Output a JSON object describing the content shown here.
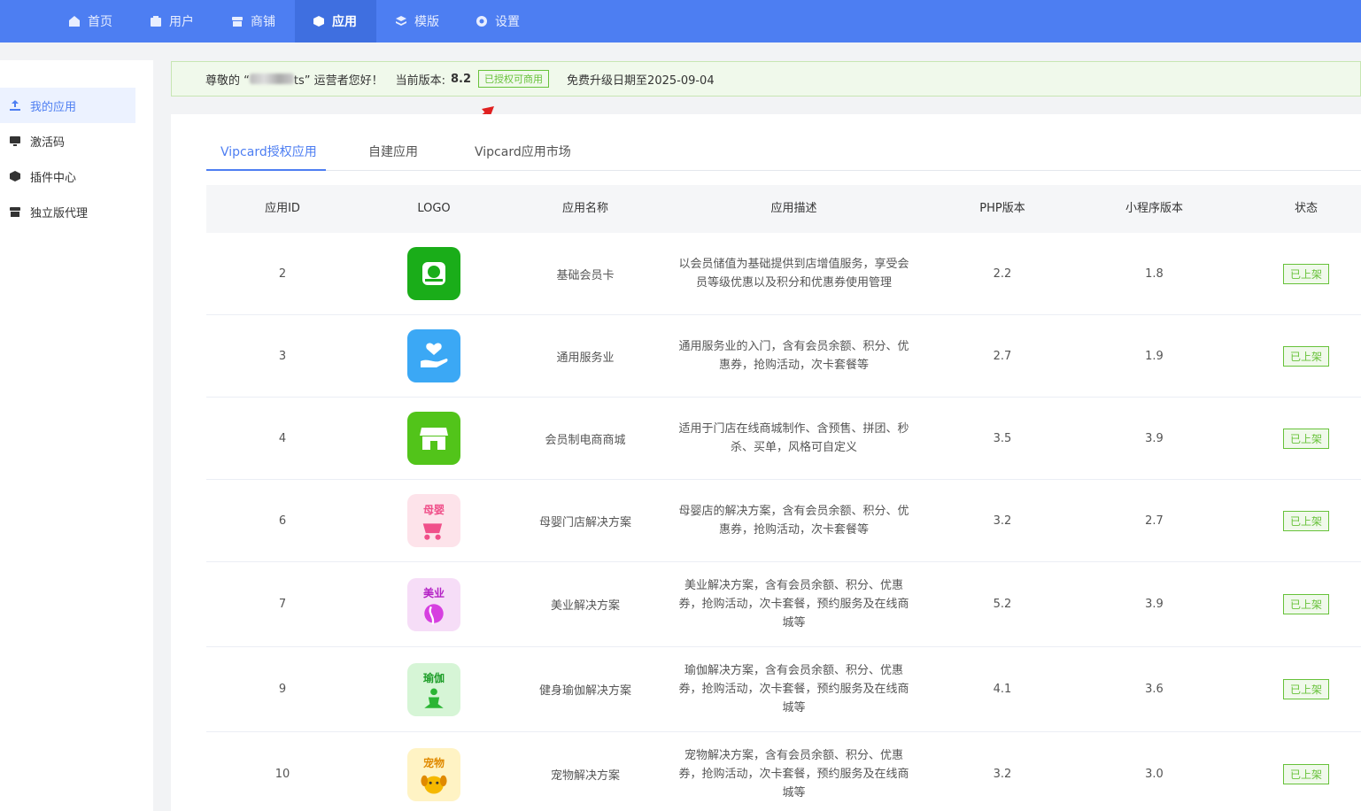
{
  "nav": {
    "items": [
      {
        "label": "首页",
        "icon": "home-icon"
      },
      {
        "label": "用户",
        "icon": "user-icon"
      },
      {
        "label": "商铺",
        "icon": "store-icon"
      },
      {
        "label": "应用",
        "icon": "cube-icon",
        "active": true
      },
      {
        "label": "模版",
        "icon": "layers-icon"
      },
      {
        "label": "设置",
        "icon": "gear-icon"
      }
    ]
  },
  "sidebar": {
    "items": [
      {
        "label": "我的应用",
        "icon": "upload-icon",
        "active": true
      },
      {
        "label": "激活码",
        "icon": "screen-icon"
      },
      {
        "label": "插件中心",
        "icon": "box-icon"
      },
      {
        "label": "独立版代理",
        "icon": "store-icon"
      }
    ]
  },
  "notice": {
    "greeting_prefix": "尊敬的 “",
    "greeting_suffix": "ts” 运营者您好！",
    "version_label": "当前版本:",
    "version": "8.2",
    "license_badge": "已授权可商用",
    "upgrade_text": "免费升级日期至2025-09-04"
  },
  "tabs": [
    {
      "label": "Vipcard授权应用",
      "active": true
    },
    {
      "label": "自建应用"
    },
    {
      "label": "Vipcard应用市场"
    }
  ],
  "table": {
    "headers": [
      "应用ID",
      "LOGO",
      "应用名称",
      "应用描述",
      "PHP版本",
      "小程序版本",
      "状态"
    ],
    "rows": [
      {
        "id": "2",
        "logo": "member-card-logo",
        "name": "基础会员卡",
        "desc": "以会员储值为基础提供到店增值服务，享受会员等级优惠以及积分和优惠券使用管理",
        "php": "2.2",
        "mini": "1.8",
        "status": "已上架"
      },
      {
        "id": "3",
        "logo": "heart-hand-logo",
        "name": "通用服务业",
        "desc": "通用服务业的入门，含有会员余额、积分、优惠券，抢购活动，次卡套餐等",
        "php": "2.7",
        "mini": "1.9",
        "status": "已上架"
      },
      {
        "id": "4",
        "logo": "shop-logo",
        "name": "会员制电商商城",
        "desc": "适用于门店在线商城制作、含预售、拼团、秒杀、买单，风格可自定义",
        "php": "3.5",
        "mini": "3.9",
        "status": "已上架"
      },
      {
        "id": "6",
        "logo": "baby-logo",
        "logo_text": "母婴",
        "name": "母婴门店解决方案",
        "desc": "母婴店的解决方案，含有会员余额、积分、优惠券，抢购活动，次卡套餐等",
        "php": "3.2",
        "mini": "2.7",
        "status": "已上架"
      },
      {
        "id": "7",
        "logo": "beauty-logo",
        "logo_text": "美业",
        "name": "美业解决方案",
        "desc": "美业解决方案，含有会员余额、积分、优惠券，抢购活动，次卡套餐，预约服务及在线商城等",
        "php": "5.2",
        "mini": "3.9",
        "status": "已上架"
      },
      {
        "id": "9",
        "logo": "yoga-logo",
        "logo_text": "瑜伽",
        "name": "健身瑜伽解决方案",
        "desc": "瑜伽解决方案，含有会员余额、积分、优惠券，抢购活动，次卡套餐，预约服务及在线商城等",
        "php": "4.1",
        "mini": "3.6",
        "status": "已上架"
      },
      {
        "id": "10",
        "logo": "pet-logo",
        "logo_text": "宠物",
        "name": "宠物解决方案",
        "desc": "宠物解决方案，含有会员余额、积分、优惠券，抢购活动，次卡套餐，预约服务及在线商城等",
        "php": "3.2",
        "mini": "3.0",
        "status": "已上架"
      }
    ]
  },
  "colors": {
    "nav": "#4d7ef2",
    "accent": "#4d7ef2",
    "success": "#67c23a"
  }
}
